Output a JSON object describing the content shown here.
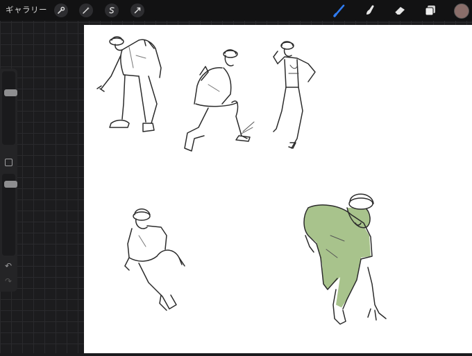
{
  "topbar": {
    "gallery_label": "ギャラリー",
    "tools_left": [
      "wrench-icon",
      "magic-wand-icon",
      "selection-icon",
      "transform-arrow-icon"
    ],
    "tools_right": [
      "brush-icon",
      "smudge-icon",
      "eraser-icon",
      "layers-icon"
    ],
    "active_tool": "brush",
    "color_swatch": "#8a6e6a",
    "accent": "#2f7bf0"
  },
  "sidebar": {
    "brush_size_level": 0.2,
    "opacity_level": 0.1,
    "undo_icon": "undo-icon",
    "redo_icon": "redo-icon"
  },
  "canvas": {
    "fill_color_figure": "#a8c38c"
  }
}
